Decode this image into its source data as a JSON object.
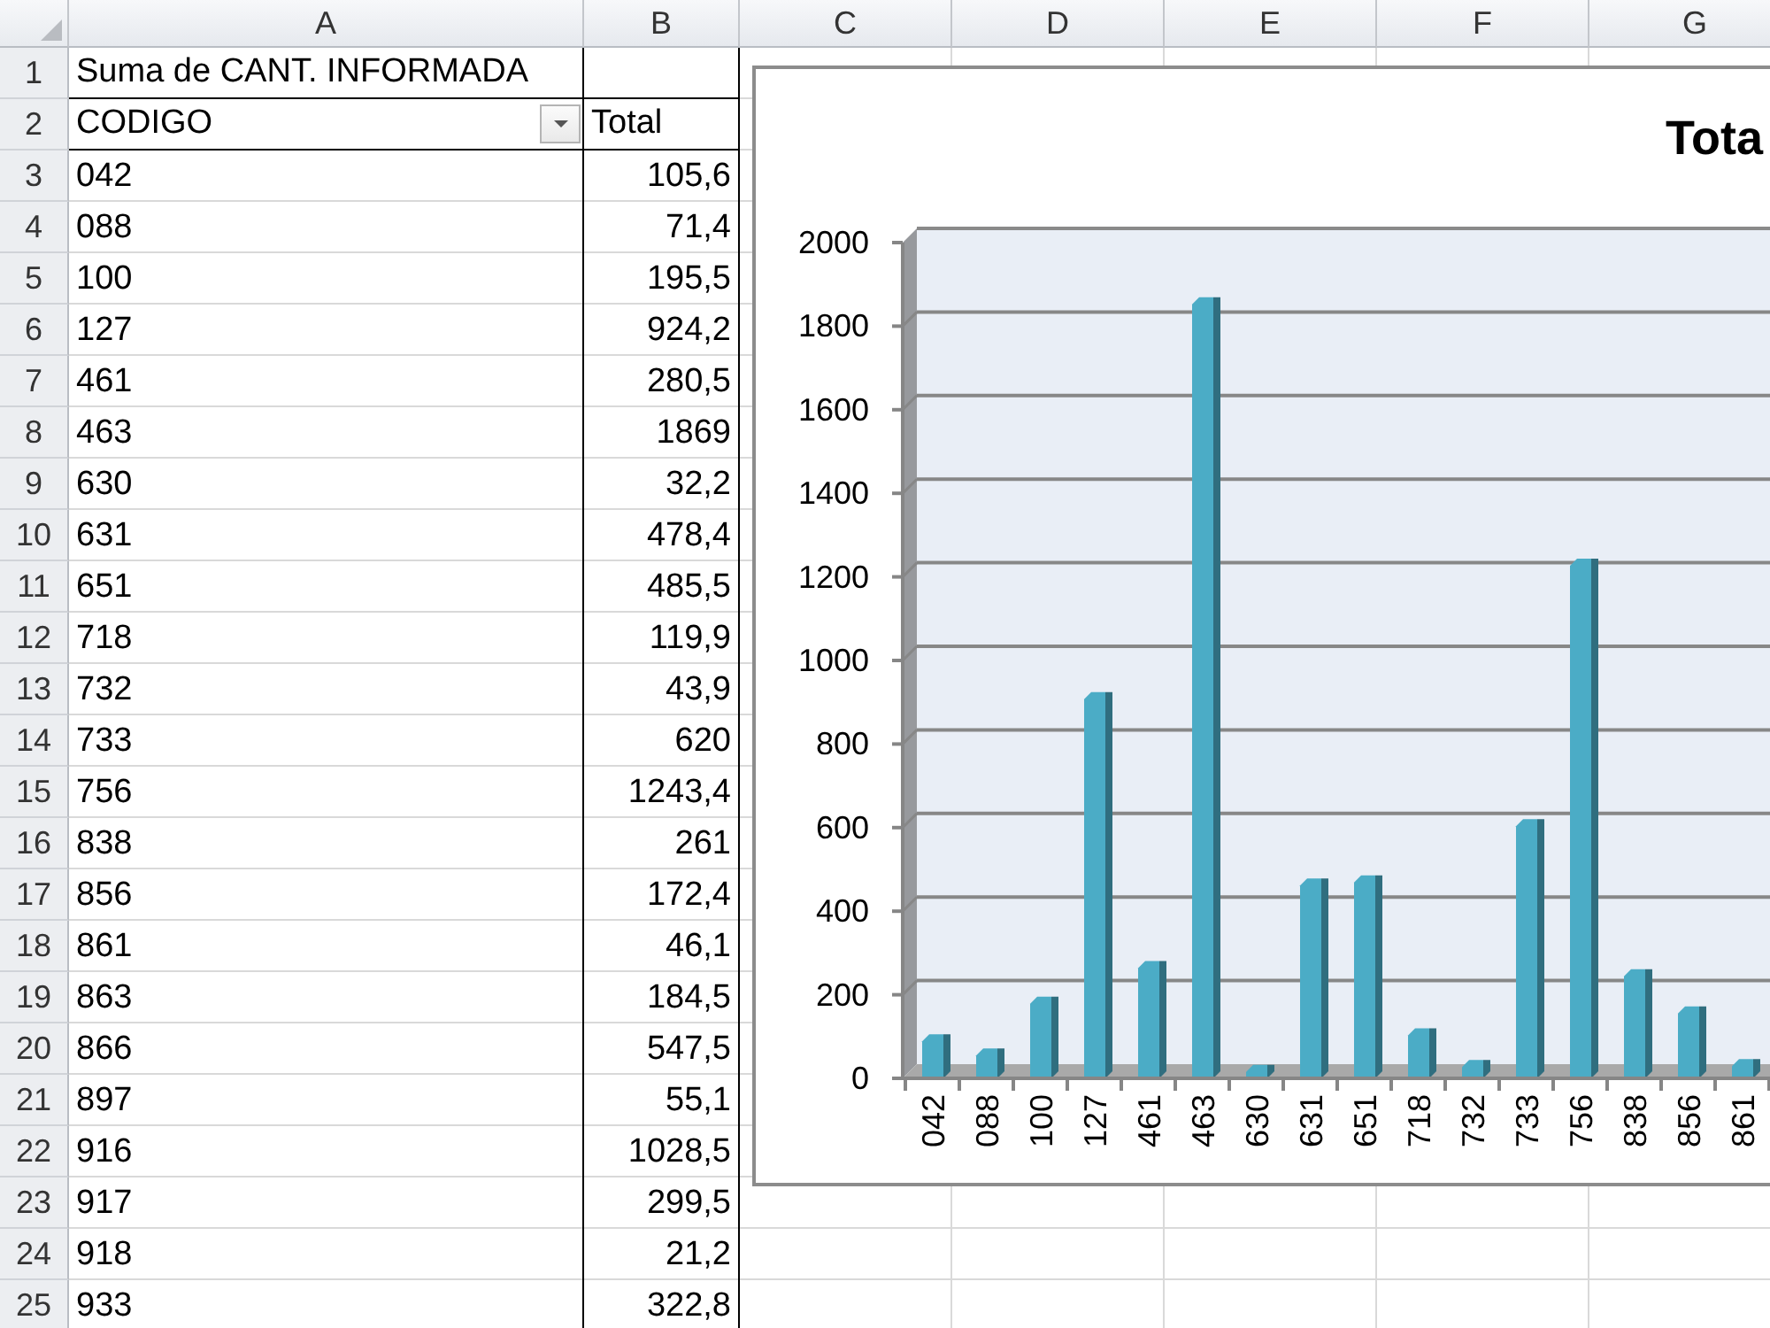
{
  "sheet": {
    "columns": [
      "A",
      "B",
      "C",
      "D",
      "E",
      "F",
      "G"
    ],
    "row_numbers": [
      "1",
      "2",
      "3",
      "4",
      "5",
      "6",
      "7",
      "8",
      "9",
      "10",
      "11",
      "12",
      "13",
      "14",
      "15",
      "16",
      "17",
      "18",
      "19",
      "20",
      "21",
      "22",
      "23",
      "24",
      "25"
    ],
    "pivot": {
      "title": "Suma de CANT. INFORMADA",
      "row_field": "CODIGO",
      "value_field": "Total",
      "rows": [
        {
          "code": "042",
          "total": "105,6"
        },
        {
          "code": "088",
          "total": "71,4"
        },
        {
          "code": "100",
          "total": "195,5"
        },
        {
          "code": "127",
          "total": "924,2"
        },
        {
          "code": "461",
          "total": "280,5"
        },
        {
          "code": "463",
          "total": "1869"
        },
        {
          "code": "630",
          "total": "32,2"
        },
        {
          "code": "631",
          "total": "478,4"
        },
        {
          "code": "651",
          "total": "485,5"
        },
        {
          "code": "718",
          "total": "119,9"
        },
        {
          "code": "732",
          "total": "43,9"
        },
        {
          "code": "733",
          "total": "620"
        },
        {
          "code": "756",
          "total": "1243,4"
        },
        {
          "code": "838",
          "total": "261"
        },
        {
          "code": "856",
          "total": "172,4"
        },
        {
          "code": "861",
          "total": "46,1"
        },
        {
          "code": "863",
          "total": "184,5"
        },
        {
          "code": "866",
          "total": "547,5"
        },
        {
          "code": "897",
          "total": "55,1"
        },
        {
          "code": "916",
          "total": "1028,5"
        },
        {
          "code": "917",
          "total": "299,5"
        },
        {
          "code": "918",
          "total": "21,2"
        },
        {
          "code": "933",
          "total": "322,8"
        }
      ]
    }
  },
  "chart": {
    "chart_data": {
      "type": "bar",
      "title": "Tota",
      "categories": [
        "042",
        "088",
        "100",
        "127",
        "461",
        "463",
        "630",
        "631",
        "651",
        "718",
        "732",
        "733",
        "756",
        "838",
        "856",
        "861"
      ],
      "series": [
        {
          "color": "#4bacc6",
          "values": [
            105.6,
            71.4,
            195.5,
            924.2,
            280.5,
            1869,
            32.2,
            478.4,
            485.5,
            119.9,
            43.9,
            620,
            1243.4,
            261,
            172.4,
            46.1
          ]
        }
      ],
      "ylim": [
        0,
        2000
      ],
      "yticks": [
        0,
        200,
        400,
        600,
        800,
        1000,
        1200,
        1400,
        1600,
        1800,
        2000
      ]
    }
  }
}
